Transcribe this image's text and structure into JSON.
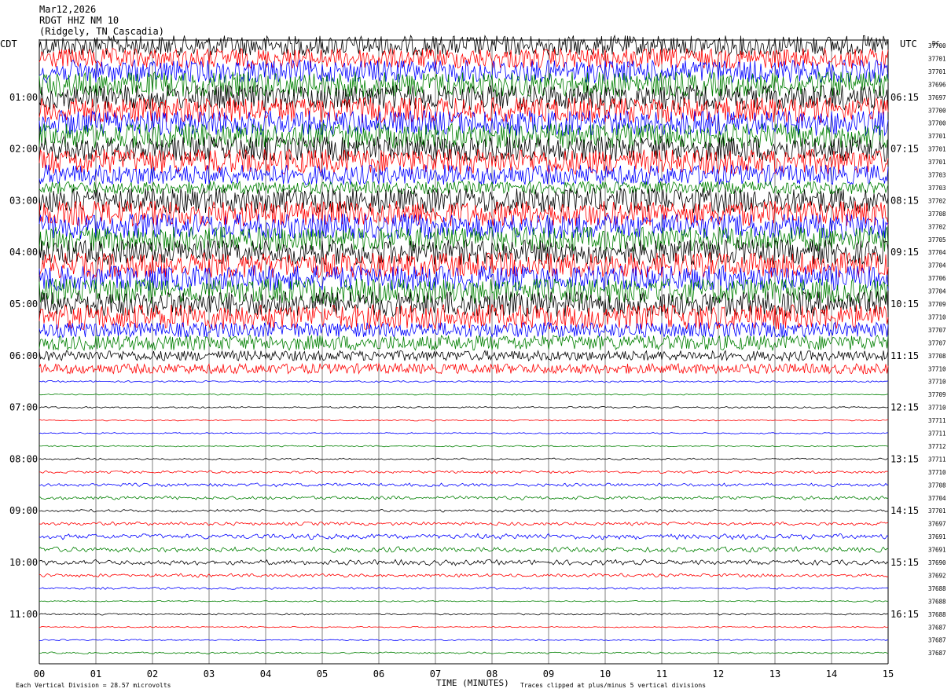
{
  "header": {
    "date": "Mar12,2026",
    "station": "RDGT HHZ NM 10",
    "location": "(Ridgely, TN Cascadia)"
  },
  "axes": {
    "left_tz": "CDT",
    "right_tz": "UTC",
    "xlabel": "TIME (MINUTES)",
    "footer_left": "Each Vertical Division =   28.57 microvolts",
    "footer_right": "Traces clipped at plus/minus 5 vertical divisions",
    "dc_label": "DC"
  },
  "colors": {
    "trace_cycle": [
      "#000000",
      "#ff0000",
      "#0000ff",
      "#008000"
    ],
    "grid": "#000000",
    "background": "#ffffff"
  },
  "chart_data": {
    "type": "line",
    "title": "RDGT HHZ NM 10",
    "xlabel": "TIME (MINUTES)",
    "xlim": [
      0,
      15
    ],
    "x_ticks": [
      "00",
      "01",
      "02",
      "03",
      "04",
      "05",
      "06",
      "07",
      "08",
      "09",
      "10",
      "11",
      "12",
      "13",
      "14",
      "15"
    ],
    "left_hour_labels": [
      "01:00",
      "02:00",
      "03:00",
      "04:00",
      "05:00",
      "06:00",
      "07:00",
      "08:00",
      "09:00",
      "10:00",
      "11:00"
    ],
    "right_hour_labels": [
      "06:15",
      "07:15",
      "08:15",
      "09:15",
      "10:15",
      "11:15",
      "12:15",
      "13:15",
      "14:15",
      "15:15",
      "16:15"
    ],
    "dc_offsets": [
      "37700",
      "37701",
      "37701",
      "37696",
      "37697",
      "37700",
      "37700",
      "37701",
      "37701",
      "37701",
      "37703",
      "37703",
      "37702",
      "37708",
      "37702",
      "37705",
      "37704",
      "37704",
      "37706",
      "37704",
      "37709",
      "37710",
      "37707",
      "37707",
      "37708",
      "37710",
      "37710",
      "37709",
      "37710",
      "37711",
      "37711",
      "37712",
      "37711",
      "37710",
      "37708",
      "37704",
      "37701",
      "37697",
      "37691",
      "37691",
      "37690",
      "37692",
      "37688",
      "37688",
      "37688",
      "37687",
      "37687",
      "37687"
    ],
    "trace_amplitude_divisions": [
      4,
      4,
      4.5,
      5,
      5,
      5,
      5,
      5,
      5,
      5,
      4,
      2.5,
      5,
      5,
      5,
      5,
      5,
      5,
      5,
      5,
      5,
      5,
      3,
      3,
      2,
      2,
      0.4,
      0.3,
      0.4,
      0.3,
      0.3,
      0.3,
      0.4,
      0.6,
      0.8,
      0.8,
      0.6,
      0.8,
      1.2,
      1.2,
      1.2,
      0.8,
      0.5,
      0.3,
      0.4,
      0.3,
      0.3,
      0.4
    ],
    "vertical_division_microvolts": 28.57,
    "clip_divisions": 5
  }
}
